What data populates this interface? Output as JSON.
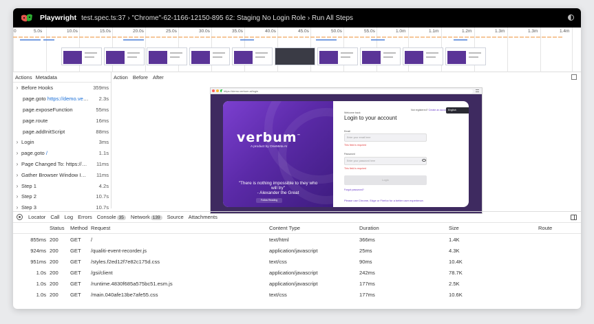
{
  "titlebar": {
    "app_name": "Playwright",
    "title": "test.spec.ts:37 › \"Chrome\"-62-1166-12150-895 62: Staging No Login Role › Run All Steps"
  },
  "timeline": {
    "ticks": [
      "0",
      "5.0s",
      "10.0s",
      "15.0s",
      "20.0s",
      "25.0s",
      "30.0s",
      "35.0s",
      "40.0s",
      "45.0s",
      "50.0s",
      "55.0s",
      "1.0m",
      "1.1m",
      "1.2m",
      "1.3m",
      "1.3m",
      "1.4m"
    ]
  },
  "actions_pane": {
    "tabs": [
      "Actions",
      "Metadata"
    ],
    "items": [
      {
        "label": "Before Hooks",
        "time": "359ms",
        "expandable": true
      },
      {
        "label": "page.goto",
        "url": "https://demo.verb...",
        "time": "2.3s",
        "expandable": false
      },
      {
        "label": "page.exposeFunction",
        "time": "55ms",
        "expandable": false
      },
      {
        "label": "page.route",
        "time": "16ms",
        "expandable": false
      },
      {
        "label": "page.addInitScript",
        "time": "88ms",
        "expandable": false
      },
      {
        "label": "Login",
        "time": "3ms",
        "expandable": true
      },
      {
        "label": "page.goto",
        "url": "/",
        "time": "1.1s",
        "expandable": true
      },
      {
        "label": "Page Changed To: https://de...",
        "time": "11ms",
        "expandable": true
      },
      {
        "label": "Gather Browser Window Info...",
        "time": "11ms",
        "expandable": true
      },
      {
        "label": "Step 1",
        "time": "4.2s",
        "expandable": true
      },
      {
        "label": "Step 2",
        "time": "10.7s",
        "expandable": true
      },
      {
        "label": "Step 3",
        "time": "10.7s",
        "expandable": true
      }
    ]
  },
  "snapshot": {
    "tabs": [
      "Action",
      "Before",
      "After"
    ],
    "url": "https://demo.verbum.ai/login",
    "page": {
      "brand": "verbum",
      "brand_mark": "™",
      "tagline": "A product by OneMeta AI",
      "quote_line1": "\"There is nothing impossible to they who",
      "quote_line2": "will try\"",
      "quote_author": "- Alexander the Great",
      "hero_button": "Follow Reading",
      "no_account": "Not registered?",
      "create_account": "Create an account",
      "language": "English",
      "welcome": "Welcome back",
      "login_title": "Login to your account",
      "email_label": "Email",
      "email_placeholder": "Enter your email here",
      "email_error": "This field is required",
      "password_label": "Password",
      "password_placeholder": "Enter your password here",
      "password_error": "This field is required",
      "login_button": "Login",
      "forgot": "Forgot password?",
      "browser_note": "Please use Chrome, Edge or Firefox for a better user experience."
    }
  },
  "bottom_tabs": {
    "items": [
      {
        "label": "Locator"
      },
      {
        "label": "Call"
      },
      {
        "label": "Log"
      },
      {
        "label": "Errors"
      },
      {
        "label": "Console",
        "count": "35"
      },
      {
        "label": "Network",
        "count": "139"
      },
      {
        "label": "Source"
      },
      {
        "label": "Attachments"
      }
    ]
  },
  "network": {
    "columns": [
      "Status",
      "Method",
      "Request",
      "Content Type",
      "Duration",
      "Size",
      "Route"
    ],
    "rows": [
      {
        "time": "855ms",
        "status": "200",
        "method": "GET",
        "request": "/",
        "type": "text/html",
        "duration": "366ms",
        "size": "1.4K"
      },
      {
        "time": "924ms",
        "status": "200",
        "method": "GET",
        "request": "/qualiti-event-recorder.js",
        "type": "application/javascript",
        "duration": "25ms",
        "size": "4.3K"
      },
      {
        "time": "951ms",
        "status": "200",
        "method": "GET",
        "request": "/styles.f2ed12f7e82c175d.css",
        "type": "text/css",
        "duration": "90ms",
        "size": "10.4K"
      },
      {
        "time": "1.0s",
        "status": "200",
        "method": "GET",
        "request": "/gsi/client",
        "type": "application/javascript",
        "duration": "242ms",
        "size": "78.7K"
      },
      {
        "time": "1.0s",
        "status": "200",
        "method": "GET",
        "request": "/runtime.4830f685a575bc51.esm.js",
        "type": "application/javascript",
        "duration": "177ms",
        "size": "2.5K"
      },
      {
        "time": "1.0s",
        "status": "200",
        "method": "GET",
        "request": "/main.040afe13be7afe55.css",
        "type": "text/css",
        "duration": "177ms",
        "size": "10.6K"
      }
    ]
  },
  "colors": {
    "titlebar_bg": "#000000",
    "link": "#1a6fd8",
    "brand_purple": "#5b2aa8",
    "error": "#e23c3c"
  }
}
